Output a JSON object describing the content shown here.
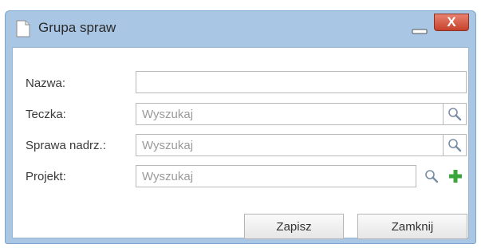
{
  "window": {
    "title": "Grupa spraw",
    "close_glyph": "X",
    "accent_color": "#a9c6e4",
    "close_color": "#c6412c"
  },
  "form": {
    "fields": [
      {
        "label": "Nazwa:",
        "value": "",
        "placeholder": ""
      },
      {
        "label": "Teczka:",
        "value": "",
        "placeholder": "Wyszukaj"
      },
      {
        "label": "Sprawa nadrz.:",
        "value": "",
        "placeholder": "Wyszukaj"
      },
      {
        "label": "Projekt:",
        "value": "",
        "placeholder": "Wyszukaj"
      }
    ]
  },
  "buttons": {
    "save_label": "Zapisz",
    "close_label": "Zamknij"
  },
  "icons": [
    "document-icon",
    "minimize-icon",
    "close-icon",
    "search-icon",
    "add-icon"
  ]
}
